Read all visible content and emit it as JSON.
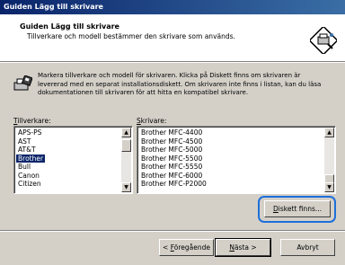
{
  "window": {
    "title": "Guiden Lägg till skrivare"
  },
  "header": {
    "title": "Guiden Lägg till skrivare",
    "subtitle": "Tillverkare och modell bestämmer den skrivare som används.",
    "icon": "printer-wizard-icon"
  },
  "instructions": {
    "text": "Markera tillverkare och modell för skrivaren. Klicka på Diskett finns om skrivaren är levererad med en separat installationsdiskett. Om skrivaren inte finns i listan, kan du läsa dokumentationen till skrivaren för att hitta en kompatibel skrivare.",
    "icon": "printer-disk-icon"
  },
  "manufacturers": {
    "label_accel": "T",
    "label_rest": "illverkare:",
    "items": [
      "APS-PS",
      "AST",
      "AT&T",
      "Brother",
      "Bull",
      "Canon",
      "Citizen"
    ],
    "selected": "Brother"
  },
  "printers": {
    "label_accel": "S",
    "label_rest": "krivare:",
    "items": [
      "Brother MFC-4400",
      "Brother MFC-4500",
      "Brother MFC-5000",
      "Brother MFC-5500",
      "Brother MFC-5550",
      "Brother MFC-6000",
      "Brother MFC-P2000"
    ]
  },
  "buttons": {
    "have_disk_accel": "D",
    "have_disk_rest": "iskett finns...",
    "back_prefix": "< ",
    "back_accel": "F",
    "back_rest": "öregående",
    "next_accel": "N",
    "next_rest": "ästa >",
    "cancel": "Avbryt"
  },
  "colors": {
    "selection": "#0a246a",
    "highlight_ring": "#1e6fd9"
  }
}
